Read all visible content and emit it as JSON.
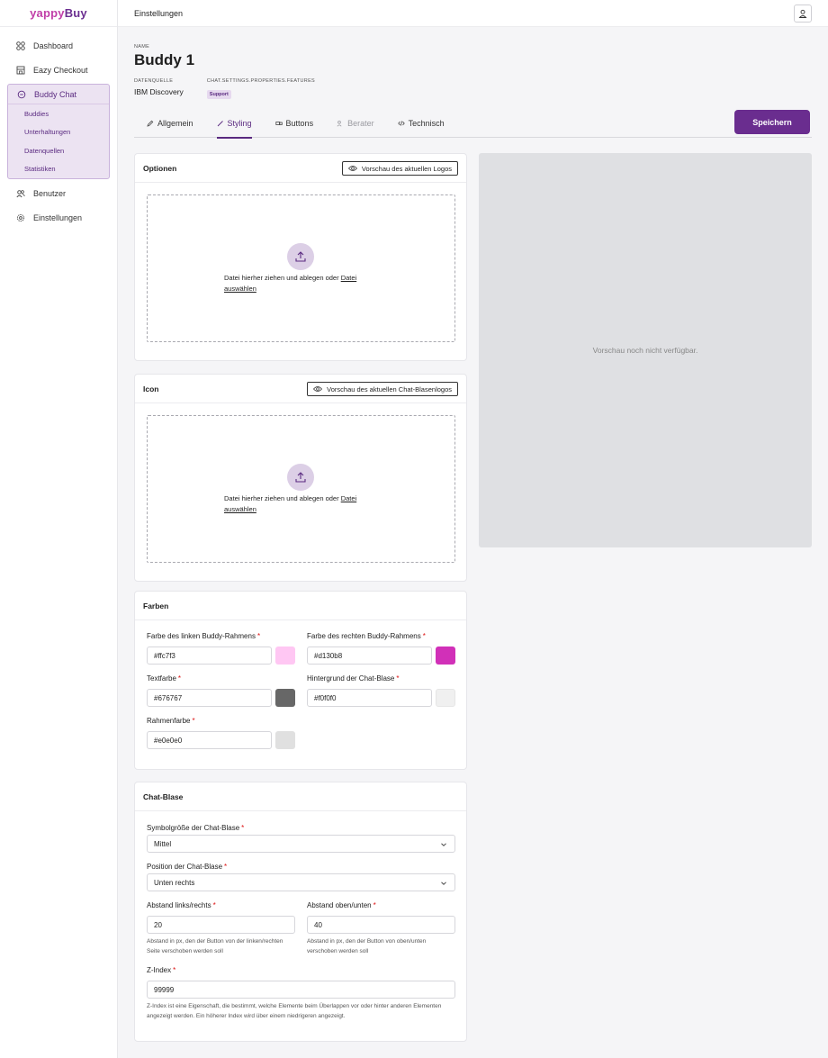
{
  "brand": {
    "logo_part1": "yappy",
    "logo_part2": "Buy"
  },
  "sidebar": {
    "items": [
      {
        "label": "Dashboard",
        "icon": "grid-icon"
      },
      {
        "label": "Eazy Checkout",
        "icon": "store-icon"
      },
      {
        "label": "Buddy Chat",
        "icon": "chat-icon"
      },
      {
        "label": "Benutzer",
        "icon": "users-icon"
      },
      {
        "label": "Einstellungen",
        "icon": "gear-icon"
      }
    ],
    "subitems": [
      "Buddies",
      "Unterhaltungen",
      "Datenquellen",
      "Statistiken"
    ]
  },
  "topbar": {
    "title": "Einstellungen"
  },
  "header": {
    "name_label": "NAME",
    "name": "Buddy 1",
    "source_label": "DATENQUELLE",
    "source_value": "IBM Discovery",
    "features_label": "CHAT.SETTINGS.PROPERTIES.FEATURES",
    "feature_badge": "Support"
  },
  "tabs": [
    {
      "label": "Allgemein",
      "state": "normal"
    },
    {
      "label": "Styling",
      "state": "active"
    },
    {
      "label": "Buttons",
      "state": "normal"
    },
    {
      "label": "Berater",
      "state": "disabled"
    },
    {
      "label": "Technisch",
      "state": "normal"
    }
  ],
  "save_label": "Speichern",
  "optionen": {
    "title": "Optionen",
    "preview_btn": "Vorschau des aktuellen Logos",
    "drop_text": "Datei hierher ziehen und ablegen oder ",
    "drop_link1": "Datei",
    "drop_link2": "auswählen"
  },
  "icon_card": {
    "title": "Icon",
    "preview_btn": "Vorschau des aktuellen Chat-Blasenlogos",
    "drop_text": "Datei hierher ziehen und ablegen oder ",
    "drop_link1": "Datei",
    "drop_link2": "auswählen"
  },
  "preview_text": "Vorschau noch nicht verfügbar.",
  "farben": {
    "title": "Farben",
    "left_frame_label": "Farbe des linken Buddy-Rahmens",
    "left_frame_value": "#ffc7f3",
    "right_frame_label": "Farbe des rechten Buddy-Rahmens",
    "right_frame_value": "#d130b8",
    "text_label": "Textfarbe",
    "text_value": "#676767",
    "bubble_bg_label": "Hintergrund der Chat-Blase",
    "bubble_bg_value": "#f0f0f0",
    "border_label": "Rahmenfarbe",
    "border_value": "#e0e0e0"
  },
  "chatblase": {
    "title": "Chat-Blase",
    "size_label": "Symbolgröße der Chat-Blase",
    "size_value": "Mittel",
    "position_label": "Position der Chat-Blase",
    "position_value": "Unten rechts",
    "lr_label": "Abstand links/rechts",
    "lr_value": "20",
    "lr_help": "Abstand in px, den der Button von der linken/rechten Seite verschoben werden soll",
    "tb_label": "Abstand oben/unten",
    "tb_value": "40",
    "tb_help": "Abstand in px, den der Button von oben/unten verschoben werden soll",
    "z_label": "Z-Index",
    "z_value": "99999",
    "z_help": "Z-Index ist eine Eigenschaft, die bestimmt, welche Elemente beim Überlappen vor oder hinter anderen Elementen angezeigt werden. Ein höherer Index wird über einem niedrigeren angezeigt."
  },
  "required_mark": "*",
  "colors": {
    "accent": "#6a2d8f",
    "brand_pink": "#c13ea8"
  }
}
